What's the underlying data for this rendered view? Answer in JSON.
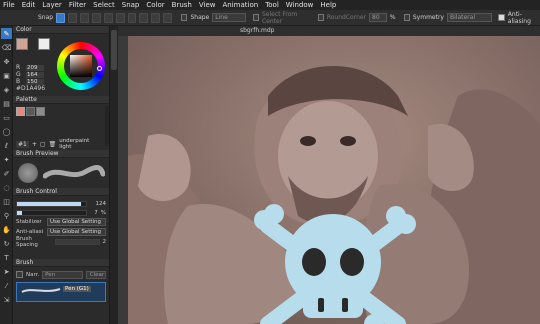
{
  "menu": [
    "File",
    "Edit",
    "Layer",
    "Filter",
    "Select",
    "Snap",
    "Color",
    "Brush",
    "View",
    "Animation",
    "Tool",
    "Window",
    "Help"
  ],
  "toolbar": {
    "snap_label": "Snap",
    "shape_label": "Shape",
    "shape_value": "Line",
    "select_from_center": "Select From Center",
    "round_corner_label": "RoundCorner",
    "round_corner_value": "80",
    "percent": "%",
    "symmetry_label": "Symmetry",
    "symmetry_value": "Bilateral",
    "antialiasing_label": "Anti-aliasing"
  },
  "color_panel": {
    "title": "Color",
    "r_label": "R",
    "r_value": "209",
    "g_label": "G",
    "g_value": "164",
    "b_label": "B",
    "b_value": "150",
    "hex": "#D1A496",
    "fg_color": "#D1A496",
    "bg_color": "#EDEDED"
  },
  "palette_panel": {
    "title": "Palette",
    "swatches": [
      "#E08B7E",
      "#5A5A5A",
      "#8C8C8C"
    ],
    "palette_number": "#1",
    "palette_name": "underpaint light"
  },
  "brush_preview": {
    "title": "Brush Preview"
  },
  "brush_control": {
    "title": "Brush Control",
    "size_value": "124",
    "size_fraction": 0.93,
    "opacity_value": "7",
    "opacity_unit": "%",
    "opacity_fraction": 0.07,
    "stabilizer_label": "Stabilizer",
    "stabilizer_value": "Use Global Setting",
    "antialias_label": "Anti-aliasi",
    "antialias_value": "Use Global Setting",
    "spacing_label": "Brush Spacing",
    "spacing_value": "2"
  },
  "brush_panel": {
    "title": "Brush",
    "narrow_label": "Narr.",
    "pen_label": "Pen",
    "clear_label": "Clear",
    "item_label": "Pen (G1)"
  },
  "canvas": {
    "tab_title": "sbgrfh.mdp"
  }
}
